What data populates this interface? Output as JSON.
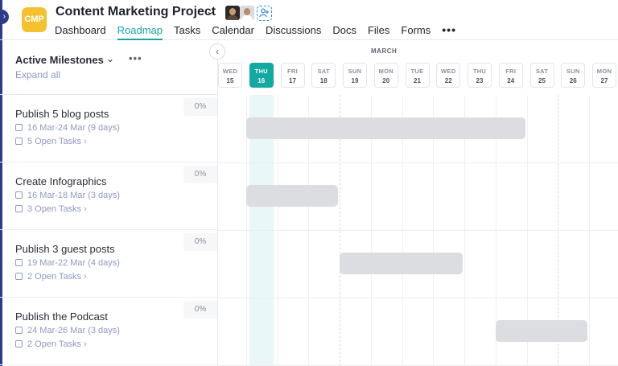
{
  "header": {
    "logo_text": "CMP",
    "project_title": "Content Marketing Project",
    "title_chevron": "⌄",
    "add_member_icon": "person-plus-icon"
  },
  "nav": {
    "tabs": [
      {
        "label": "Dashboard",
        "active": false
      },
      {
        "label": "Roadmap",
        "active": true
      },
      {
        "label": "Tasks",
        "active": false
      },
      {
        "label": "Calendar",
        "active": false
      },
      {
        "label": "Discussions",
        "active": false
      },
      {
        "label": "Docs",
        "active": false
      },
      {
        "label": "Files",
        "active": false
      },
      {
        "label": "Forms",
        "active": false
      }
    ],
    "more": "•••"
  },
  "panel": {
    "title": "Active Milestones",
    "chevron": "⌄",
    "more": "•••",
    "expand_all": "Expand all"
  },
  "milestones": [
    {
      "name": "Publish 5 blog posts",
      "dates": "16 Mar-24 Mar (9 days)",
      "tasks": "5 Open Tasks",
      "progress": "0%"
    },
    {
      "name": "Create Infographics",
      "dates": "16 Mar-18 Mar (3 days)",
      "tasks": "3 Open Tasks",
      "progress": "0%"
    },
    {
      "name": "Publish 3 guest posts",
      "dates": "19 Mar-22 Mar (4 days)",
      "tasks": "2 Open Tasks",
      "progress": "0%"
    },
    {
      "name": "Publish the Podcast",
      "dates": "24 Mar-26 Mar (3 days)",
      "tasks": "2 Open Tasks",
      "progress": "0%"
    }
  ],
  "timeline": {
    "month": "MARCH",
    "back_icon": "‹",
    "days": [
      {
        "name": "WED",
        "date": "15"
      },
      {
        "name": "THU",
        "date": "16",
        "today": true
      },
      {
        "name": "FRI",
        "date": "17"
      },
      {
        "name": "SAT",
        "date": "18"
      },
      {
        "name": "SUN",
        "date": "19"
      },
      {
        "name": "MON",
        "date": "20"
      },
      {
        "name": "TUE",
        "date": "21"
      },
      {
        "name": "WED",
        "date": "22"
      },
      {
        "name": "THU",
        "date": "23"
      },
      {
        "name": "FRI",
        "date": "24"
      },
      {
        "name": "SAT",
        "date": "25"
      },
      {
        "name": "SUN",
        "date": "26"
      },
      {
        "name": "MON",
        "date": "27"
      }
    ],
    "bars": [
      {
        "start": "16",
        "end": "24"
      },
      {
        "start": "16",
        "end": "18"
      },
      {
        "start": "19",
        "end": "22"
      },
      {
        "start": "24",
        "end": "26"
      }
    ]
  }
}
